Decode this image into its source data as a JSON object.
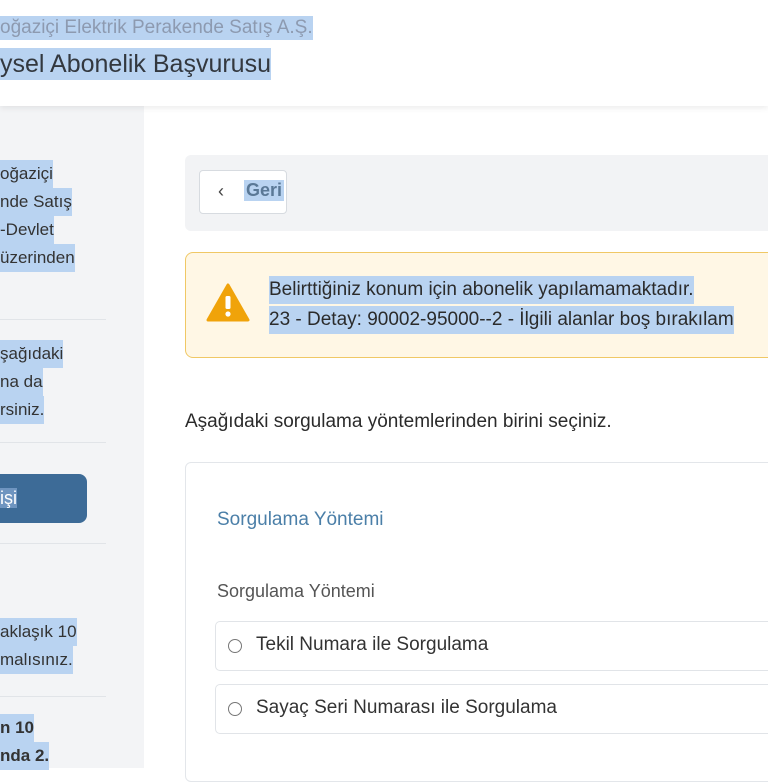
{
  "header": {
    "company": "oğaziçi Elektrik Perakende Satış A.Ş.",
    "title": "ysel Abonelik Başvurusu"
  },
  "sidebar": {
    "block1": [
      "oğaziçi",
      "nde Satış",
      "-Devlet",
      "üzerinden"
    ],
    "block2": [
      "şağıdaki",
      "na da",
      "rsiniz."
    ],
    "button_label": "işi",
    "block3": [
      "aklaşık 10",
      "malısınız."
    ],
    "block4": [
      "n 10",
      "nda 2."
    ]
  },
  "main": {
    "back_label": "Geri",
    "alert": {
      "line1": "Belirttiğiniz konum için abonelik yapılamamaktadır.",
      "line2": "23 - Detay: 90002-95000--2 - İlgili alanlar boş bırakılam"
    },
    "instruction": "Aşağıdaki sorgulama yöntemlerinden birini seçiniz.",
    "card": {
      "title": "Sorgulama Yöntemi",
      "field_label": "Sorgulama Yöntemi",
      "options": [
        {
          "label": "Tekil Numara ile Sorgulama"
        },
        {
          "label": "Sayaç Seri Numarası ile Sorgulama"
        }
      ]
    }
  },
  "colors": {
    "accent": "#3d6b97",
    "warning": "#f0a30a",
    "selection": "#b9d3f1"
  },
  "icons": {
    "back": "chevron-left-icon",
    "alert": "warning-triangle-icon",
    "radio": "radio-empty-icon"
  }
}
